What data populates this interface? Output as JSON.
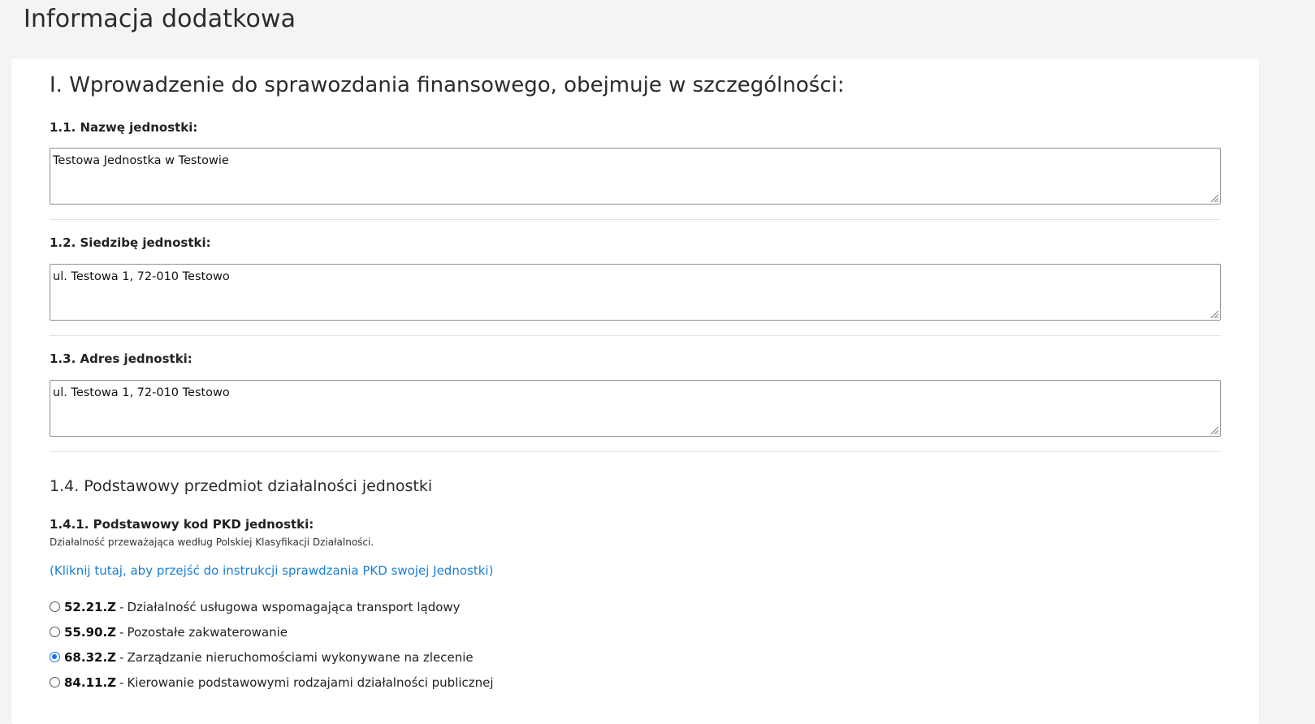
{
  "page": {
    "title": "Informacja dodatkowa"
  },
  "section": {
    "heading": "I. Wprowadzenie do sprawozdania finansowego, obejmuje w szczególności:"
  },
  "fields": [
    {
      "label": "1.1. Nazwę jednostki:",
      "value": "Testowa Jednostka w Testowie"
    },
    {
      "label": "1.2. Siedzibę jednostki:",
      "value": "ul. Testowa 1, 72-010 Testowo"
    },
    {
      "label": "1.3. Adres jednostki:",
      "value": "ul. Testowa 1, 72-010 Testowo"
    }
  ],
  "activity": {
    "heading": "1.4. Podstawowy przedmiot działalności jednostki",
    "pkd_label": "1.4.1. Podstawowy kod PKD jednostki:",
    "pkd_help": "Działalność przeważająca według Polskiej Klasyfikacji Działalności.",
    "instructions_link": "(Kliknij tutaj, aby przejść do instrukcji sprawdzania PKD swojej Jednostki)",
    "separator": "-",
    "options": [
      {
        "code": "52.21.Z",
        "description": "Działalność usługowa wspomagająca transport lądowy",
        "selected": false
      },
      {
        "code": "55.90.Z",
        "description": "Pozostałe zakwaterowanie",
        "selected": false
      },
      {
        "code": "68.32.Z",
        "description": "Zarządzanie nieruchomościami wykonywane na zlecenie",
        "selected": true
      },
      {
        "code": "84.11.Z",
        "description": "Kierowanie podstawowymi rodzajami działalności publicznej",
        "selected": false
      }
    ]
  },
  "colors": {
    "page_background": "#f4f4f4",
    "card_background": "#ffffff",
    "link": "#1a7fd4",
    "radio_selected": "#1a73e8"
  },
  "icons": {
    "resize": "resize-grip-icon",
    "radio": "radio-button-icon"
  }
}
